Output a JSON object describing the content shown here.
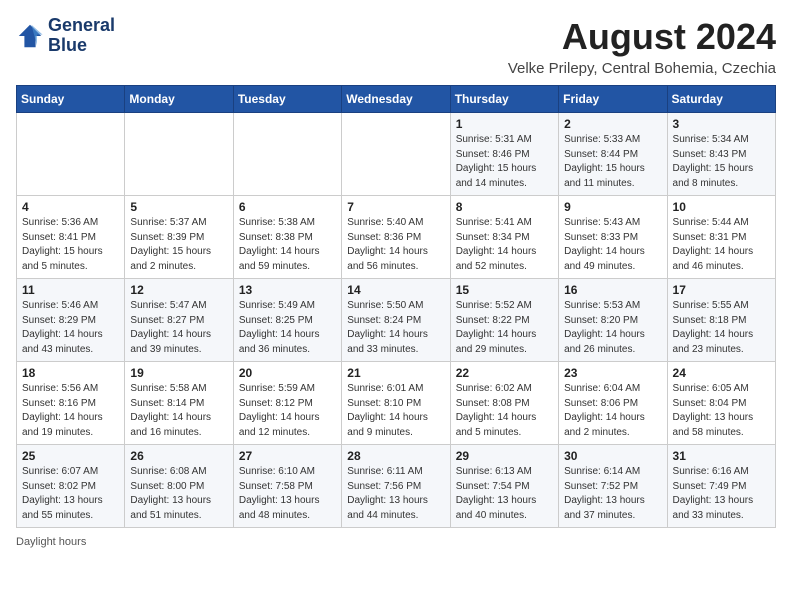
{
  "header": {
    "logo_line1": "General",
    "logo_line2": "Blue",
    "title": "August 2024",
    "subtitle": "Velke Prilepy, Central Bohemia, Czechia"
  },
  "days_of_week": [
    "Sunday",
    "Monday",
    "Tuesday",
    "Wednesday",
    "Thursday",
    "Friday",
    "Saturday"
  ],
  "weeks": [
    [
      {
        "day": "",
        "info": ""
      },
      {
        "day": "",
        "info": ""
      },
      {
        "day": "",
        "info": ""
      },
      {
        "day": "",
        "info": ""
      },
      {
        "day": "1",
        "info": "Sunrise: 5:31 AM\nSunset: 8:46 PM\nDaylight: 15 hours\nand 14 minutes."
      },
      {
        "day": "2",
        "info": "Sunrise: 5:33 AM\nSunset: 8:44 PM\nDaylight: 15 hours\nand 11 minutes."
      },
      {
        "day": "3",
        "info": "Sunrise: 5:34 AM\nSunset: 8:43 PM\nDaylight: 15 hours\nand 8 minutes."
      }
    ],
    [
      {
        "day": "4",
        "info": "Sunrise: 5:36 AM\nSunset: 8:41 PM\nDaylight: 15 hours\nand 5 minutes."
      },
      {
        "day": "5",
        "info": "Sunrise: 5:37 AM\nSunset: 8:39 PM\nDaylight: 15 hours\nand 2 minutes."
      },
      {
        "day": "6",
        "info": "Sunrise: 5:38 AM\nSunset: 8:38 PM\nDaylight: 14 hours\nand 59 minutes."
      },
      {
        "day": "7",
        "info": "Sunrise: 5:40 AM\nSunset: 8:36 PM\nDaylight: 14 hours\nand 56 minutes."
      },
      {
        "day": "8",
        "info": "Sunrise: 5:41 AM\nSunset: 8:34 PM\nDaylight: 14 hours\nand 52 minutes."
      },
      {
        "day": "9",
        "info": "Sunrise: 5:43 AM\nSunset: 8:33 PM\nDaylight: 14 hours\nand 49 minutes."
      },
      {
        "day": "10",
        "info": "Sunrise: 5:44 AM\nSunset: 8:31 PM\nDaylight: 14 hours\nand 46 minutes."
      }
    ],
    [
      {
        "day": "11",
        "info": "Sunrise: 5:46 AM\nSunset: 8:29 PM\nDaylight: 14 hours\nand 43 minutes."
      },
      {
        "day": "12",
        "info": "Sunrise: 5:47 AM\nSunset: 8:27 PM\nDaylight: 14 hours\nand 39 minutes."
      },
      {
        "day": "13",
        "info": "Sunrise: 5:49 AM\nSunset: 8:25 PM\nDaylight: 14 hours\nand 36 minutes."
      },
      {
        "day": "14",
        "info": "Sunrise: 5:50 AM\nSunset: 8:24 PM\nDaylight: 14 hours\nand 33 minutes."
      },
      {
        "day": "15",
        "info": "Sunrise: 5:52 AM\nSunset: 8:22 PM\nDaylight: 14 hours\nand 29 minutes."
      },
      {
        "day": "16",
        "info": "Sunrise: 5:53 AM\nSunset: 8:20 PM\nDaylight: 14 hours\nand 26 minutes."
      },
      {
        "day": "17",
        "info": "Sunrise: 5:55 AM\nSunset: 8:18 PM\nDaylight: 14 hours\nand 23 minutes."
      }
    ],
    [
      {
        "day": "18",
        "info": "Sunrise: 5:56 AM\nSunset: 8:16 PM\nDaylight: 14 hours\nand 19 minutes."
      },
      {
        "day": "19",
        "info": "Sunrise: 5:58 AM\nSunset: 8:14 PM\nDaylight: 14 hours\nand 16 minutes."
      },
      {
        "day": "20",
        "info": "Sunrise: 5:59 AM\nSunset: 8:12 PM\nDaylight: 14 hours\nand 12 minutes."
      },
      {
        "day": "21",
        "info": "Sunrise: 6:01 AM\nSunset: 8:10 PM\nDaylight: 14 hours\nand 9 minutes."
      },
      {
        "day": "22",
        "info": "Sunrise: 6:02 AM\nSunset: 8:08 PM\nDaylight: 14 hours\nand 5 minutes."
      },
      {
        "day": "23",
        "info": "Sunrise: 6:04 AM\nSunset: 8:06 PM\nDaylight: 14 hours\nand 2 minutes."
      },
      {
        "day": "24",
        "info": "Sunrise: 6:05 AM\nSunset: 8:04 PM\nDaylight: 13 hours\nand 58 minutes."
      }
    ],
    [
      {
        "day": "25",
        "info": "Sunrise: 6:07 AM\nSunset: 8:02 PM\nDaylight: 13 hours\nand 55 minutes."
      },
      {
        "day": "26",
        "info": "Sunrise: 6:08 AM\nSunset: 8:00 PM\nDaylight: 13 hours\nand 51 minutes."
      },
      {
        "day": "27",
        "info": "Sunrise: 6:10 AM\nSunset: 7:58 PM\nDaylight: 13 hours\nand 48 minutes."
      },
      {
        "day": "28",
        "info": "Sunrise: 6:11 AM\nSunset: 7:56 PM\nDaylight: 13 hours\nand 44 minutes."
      },
      {
        "day": "29",
        "info": "Sunrise: 6:13 AM\nSunset: 7:54 PM\nDaylight: 13 hours\nand 40 minutes."
      },
      {
        "day": "30",
        "info": "Sunrise: 6:14 AM\nSunset: 7:52 PM\nDaylight: 13 hours\nand 37 minutes."
      },
      {
        "day": "31",
        "info": "Sunrise: 6:16 AM\nSunset: 7:49 PM\nDaylight: 13 hours\nand 33 minutes."
      }
    ]
  ],
  "footer": {
    "note": "Daylight hours"
  }
}
